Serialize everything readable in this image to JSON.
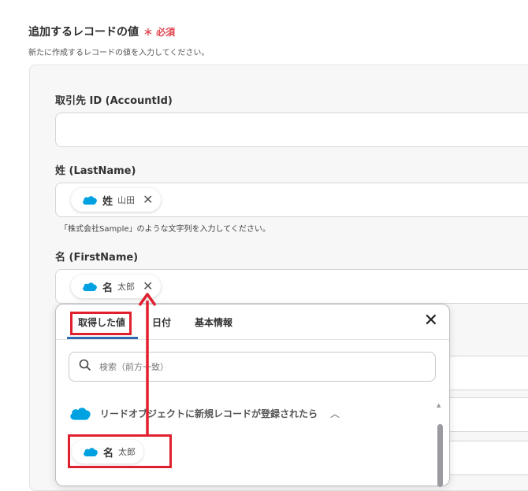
{
  "section": {
    "title": "追加するレコードの値",
    "required_mark": "＊ 必須",
    "description": "新たに作成するレコードの値を入力してください。"
  },
  "fields": {
    "account_id": {
      "label": "取引先 ID (AccountId)",
      "value": ""
    },
    "last_name": {
      "label": "姓 (LastName)",
      "chip_name": "姓",
      "chip_value": "山田",
      "hint": "「株式会社Sample」のような文字列を入力してください。"
    },
    "first_name": {
      "label": "名 (FirstName)",
      "chip_name": "名",
      "chip_value": "太郎"
    }
  },
  "popup": {
    "tabs": [
      {
        "label": "取得した値",
        "active": true
      },
      {
        "label": "日付",
        "active": false
      },
      {
        "label": "基本情報",
        "active": false
      }
    ],
    "search_placeholder": "検索（前方一致）",
    "group_label": "リードオブジェクトに新規レコードが登録されたら",
    "item": {
      "name": "名",
      "value": "太郎"
    }
  },
  "colors": {
    "salesforce_blue": "#00a1e0",
    "highlight_red": "#e0202e",
    "required_red": "#e0454f"
  },
  "icons": {
    "cloud": "salesforce-cloud-icon",
    "close": "close-icon",
    "search": "search-icon",
    "chevron": "chevron-up-icon"
  }
}
